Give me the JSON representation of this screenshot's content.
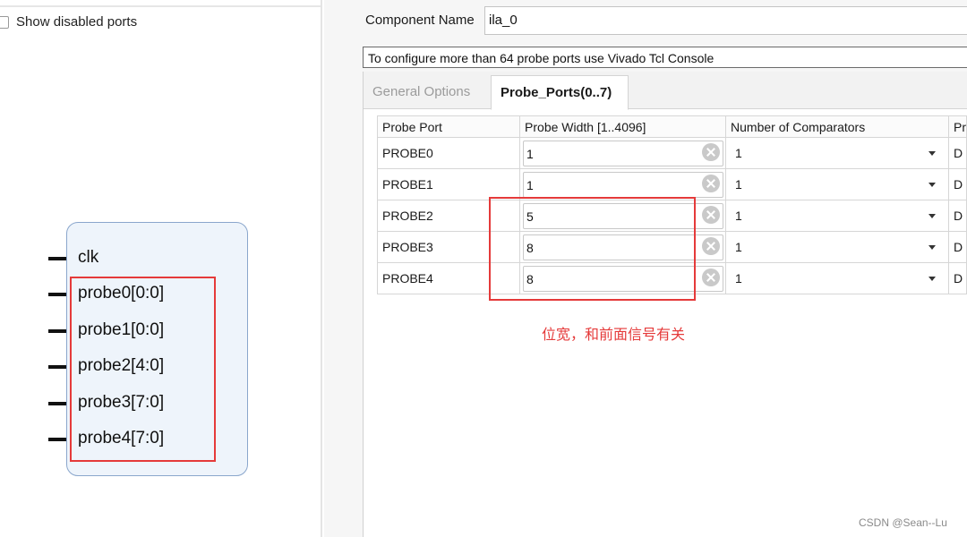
{
  "left_panel": {
    "show_disabled_label": "Show disabled ports",
    "pins": [
      "clk",
      "probe0[0:0]",
      "probe1[0:0]",
      "probe2[4:0]",
      "probe3[7:0]",
      "probe4[7:0]"
    ]
  },
  "component": {
    "label": "Component Name",
    "value": "ila_0"
  },
  "notice": "To configure more than 64 probe ports use Vivado Tcl Console",
  "tabs": {
    "general": "General Options",
    "probe_ports": "Probe_Ports(0..7)"
  },
  "table": {
    "headers": [
      "Probe Port",
      "Probe Width [1..4096]",
      "Number of Comparators",
      "Pr"
    ],
    "rows": [
      {
        "port": "PROBE0",
        "width": "1",
        "comparators": "1",
        "partial": "D"
      },
      {
        "port": "PROBE1",
        "width": "1",
        "comparators": "1",
        "partial": "D"
      },
      {
        "port": "PROBE2",
        "width": "5",
        "comparators": "1",
        "partial": "D"
      },
      {
        "port": "PROBE3",
        "width": "8",
        "comparators": "1",
        "partial": "D"
      },
      {
        "port": "PROBE4",
        "width": "8",
        "comparators": "1",
        "partial": "D"
      }
    ]
  },
  "annotation": "位宽，和前面信号有关",
  "watermark": "CSDN @Sean--Lu",
  "colors": {
    "highlight_red": "#e53a3a",
    "symbol_fill": "#eef4fb",
    "symbol_border": "#8aa6cc"
  }
}
